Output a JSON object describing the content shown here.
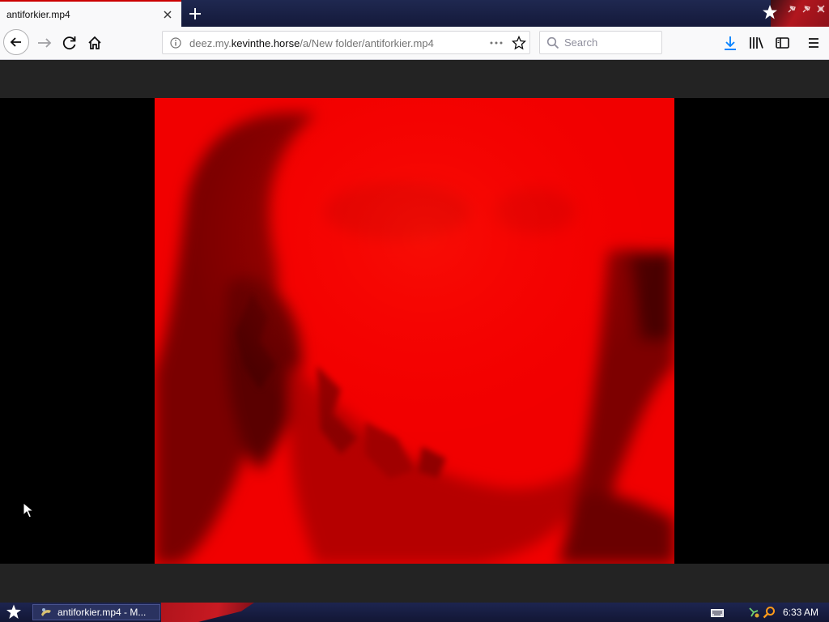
{
  "browser": {
    "tab": {
      "title": "antiforkier.mp4"
    },
    "url": {
      "prefix": "deez.my.",
      "host": "kevinthe.horse",
      "path": "/a/New folder/antiforkier.mp4"
    },
    "search": {
      "placeholder": "Search"
    }
  },
  "taskbar": {
    "task_item": {
      "label": "antiforkier.mp4 - M..."
    },
    "clock": "6:33 AM"
  },
  "colors": {
    "accent_red": "#cc0000",
    "video_red": "#ff0000",
    "download_blue": "#0a84ff",
    "taskbar_navy": "#1d2550"
  },
  "icons": [
    "close-icon",
    "plus-icon",
    "star-logo-icon",
    "pin-icon",
    "close-window-icon",
    "back-arrow-icon",
    "forward-arrow-icon",
    "reload-icon",
    "home-icon",
    "info-icon",
    "more-dots-icon",
    "bookmark-star-icon",
    "search-icon",
    "download-arrow-icon",
    "library-icon",
    "sidebar-icon",
    "hamburger-menu-icon",
    "mouse-cursor-icon",
    "keyboard-icon",
    "network-icon",
    "search-tray-icon"
  ]
}
